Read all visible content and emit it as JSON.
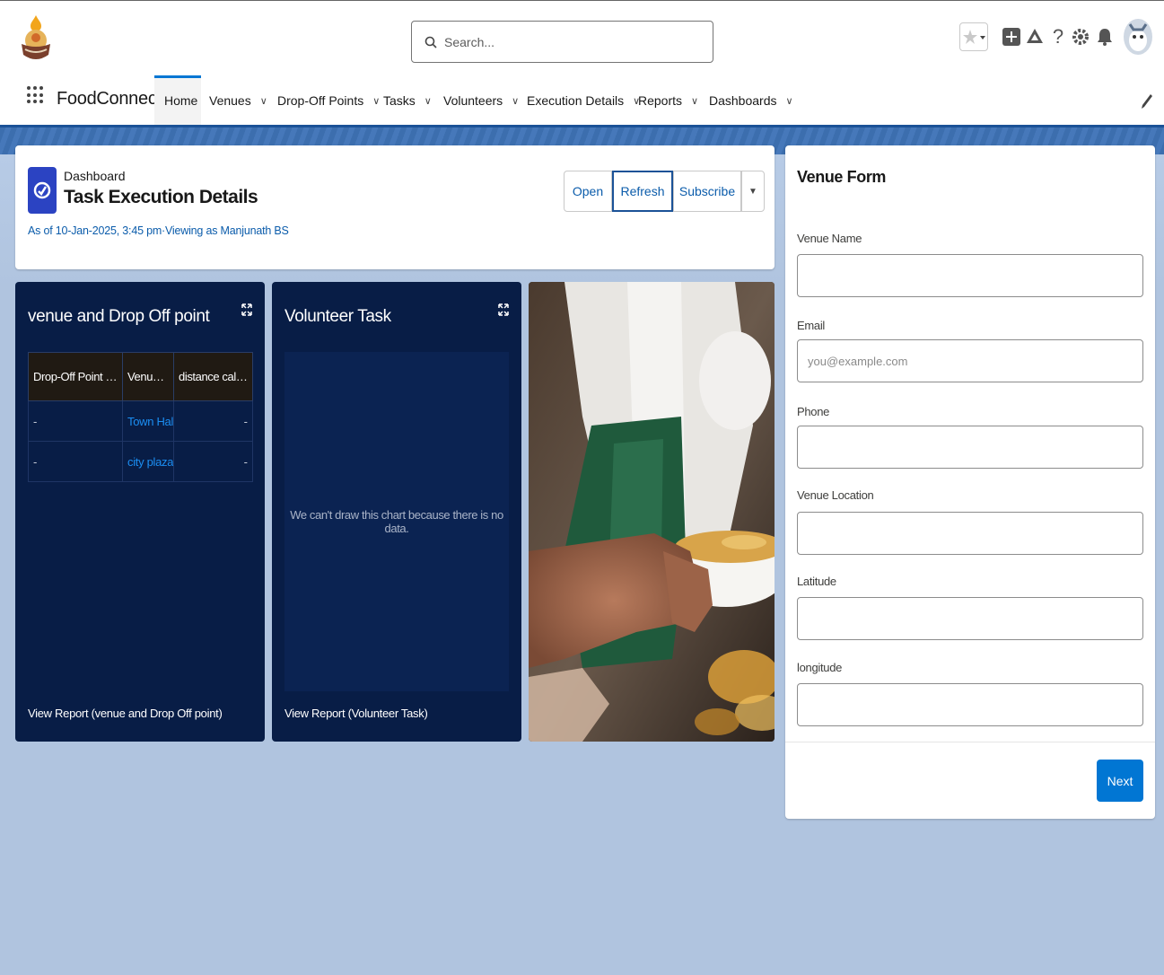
{
  "header": {
    "search_placeholder": "Search...",
    "icons": [
      "favorites-star-icon",
      "global-actions-icon",
      "trailhead-icon",
      "help-icon",
      "setup-gear-icon",
      "notifications-bell-icon",
      "avatar"
    ]
  },
  "nav": {
    "app_name": "FoodConnect",
    "items": [
      {
        "label": "Home",
        "has_dropdown": false,
        "active": true
      },
      {
        "label": "Venues",
        "has_dropdown": true
      },
      {
        "label": "Drop-Off Points",
        "has_dropdown": true
      },
      {
        "label": "Tasks",
        "has_dropdown": true
      },
      {
        "label": "Volunteers",
        "has_dropdown": true
      },
      {
        "label": "Execution Details",
        "has_dropdown": true
      },
      {
        "label": "Reports",
        "has_dropdown": true
      },
      {
        "label": "Dashboards",
        "has_dropdown": true
      }
    ],
    "chevron": "∨"
  },
  "dashboard": {
    "label": "Dashboard",
    "title": "Task Execution Details",
    "meta": "As of 10-Jan-2025, 3:45 pm·Viewing as Manjunath BS",
    "buttons": {
      "open": "Open",
      "refresh": "Refresh",
      "subscribe": "Subscribe",
      "more": "▼"
    }
  },
  "widgets": {
    "venue": {
      "title": "venue and Drop Off point",
      "columns": [
        "Drop-Off Point Na...",
        "Venue ...",
        "distance calcul..."
      ],
      "rows": [
        [
          "-",
          "Town Hall",
          "-"
        ],
        [
          "-",
          "city plaza",
          "-"
        ]
      ],
      "footer": "View Report (venue and Drop Off point)"
    },
    "volunteer": {
      "title": "Volunteer Task",
      "empty_message": "We can't draw this chart because there is no data.",
      "footer": "View Report (Volunteer Task)"
    }
  },
  "form": {
    "title": "Venue Form",
    "fields": [
      {
        "label": "Venue Name",
        "value": "",
        "placeholder": ""
      },
      {
        "label": "Email",
        "value": "",
        "placeholder": "you@example.com"
      },
      {
        "label": "Phone",
        "value": "",
        "placeholder": ""
      },
      {
        "label": "Venue Location",
        "value": "",
        "placeholder": ""
      },
      {
        "label": "Latitude",
        "value": "",
        "placeholder": ""
      },
      {
        "label": "longitude",
        "value": "",
        "placeholder": ""
      }
    ],
    "next_label": "Next"
  },
  "colors": {
    "brand_blue": "#0176d3",
    "widget_bg": "#081d46",
    "link_blue": "#0b5cab",
    "page_bg": "#b0c4df"
  }
}
